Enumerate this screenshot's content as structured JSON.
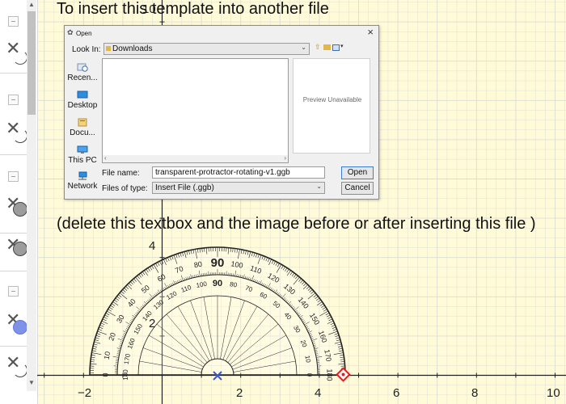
{
  "notes": {
    "top": "To insert this template into another file",
    "middle": "(delete this textbox and the image before or after inserting this file )"
  },
  "axes": {
    "x_ticks": [
      "−2",
      "2",
      "4",
      "6",
      "8",
      "10"
    ],
    "y_ticks": [
      "2",
      "4",
      "10"
    ]
  },
  "protractor": {
    "outer_labels": [
      "0",
      "10",
      "20",
      "30",
      "40",
      "50",
      "60",
      "70",
      "80",
      "90",
      "100",
      "110",
      "120",
      "130",
      "140",
      "150",
      "160",
      "170",
      "180"
    ],
    "inner_labels": [
      "180",
      "170",
      "160",
      "150",
      "140",
      "130",
      "120",
      "110",
      "100",
      "90",
      "80",
      "70",
      "60",
      "50",
      "40",
      "30",
      "20",
      "10",
      "0"
    ]
  },
  "dialog": {
    "title": "Open",
    "close": "×",
    "look_in_label": "Look In:",
    "look_in_value": "Downloads",
    "places": [
      "Recen...",
      "Desktop",
      "Docu...",
      "This PC",
      "Network"
    ],
    "file_name_label": "File name:",
    "file_name_value": "transparent-protractor-rotating-v1.ggb",
    "files_of_type_label": "Files of type:",
    "files_of_type_value": "Insert File (.ggb)",
    "preview_text": "Preview Unavailable",
    "open_label": "Open",
    "cancel_label": "Cancel"
  },
  "colors": {
    "background": "#fffbd9",
    "grid": "#dcdcd2",
    "protractor": "#222222",
    "point": "#3b57d8",
    "rotate_handle": "#e02020"
  }
}
